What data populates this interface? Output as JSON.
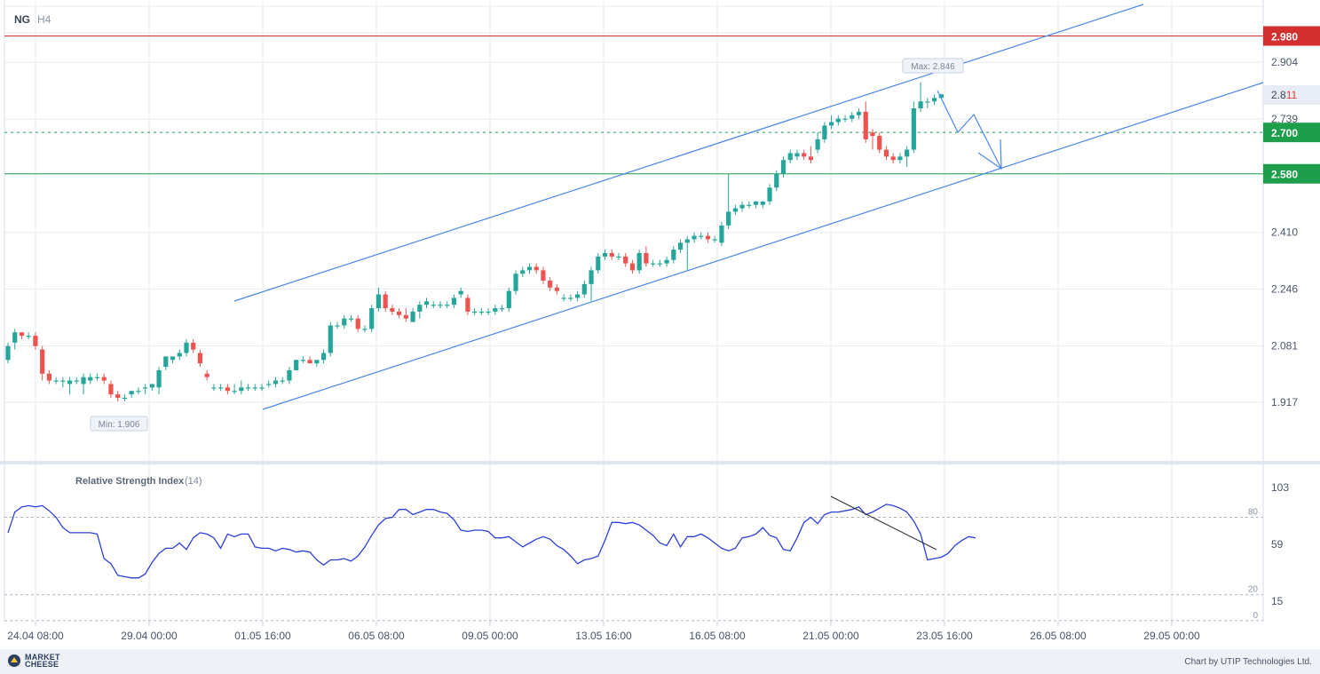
{
  "chart_data": {
    "type": "candlestick",
    "symbol": "NG",
    "timeframe": "H4",
    "x_ticks": [
      "24.04 08:00",
      "29.04 00:00",
      "01.05 16:00",
      "06.05 08:00",
      "09.05 00:00",
      "13.05 16:00",
      "16.05 08:00",
      "21.05 00:00",
      "23.05 16:00",
      "26.05 08:00",
      "29.05 00:00"
    ],
    "y_ticks": [
      "1.917",
      "2.081",
      "2.246",
      "2.410",
      "2.739",
      "2.904"
    ],
    "ylim": [
      1.75,
      3.05
    ],
    "candles": [
      {
        "o": 2.04,
        "h": 2.09,
        "l": 2.03,
        "c": 2.08
      },
      {
        "o": 2.09,
        "h": 2.13,
        "l": 2.07,
        "c": 2.12
      },
      {
        "o": 2.12,
        "h": 2.12,
        "l": 2.1,
        "c": 2.11
      },
      {
        "o": 2.11,
        "h": 2.12,
        "l": 2.1,
        "c": 2.11
      },
      {
        "o": 2.11,
        "h": 2.12,
        "l": 2.07,
        "c": 2.08
      },
      {
        "o": 2.07,
        "h": 2.08,
        "l": 1.98,
        "c": 2.0
      },
      {
        "o": 2.0,
        "h": 2.01,
        "l": 1.97,
        "c": 1.98
      },
      {
        "o": 1.98,
        "h": 1.99,
        "l": 1.97,
        "c": 1.98
      },
      {
        "o": 1.98,
        "h": 1.99,
        "l": 1.96,
        "c": 1.98
      },
      {
        "o": 1.97,
        "h": 1.99,
        "l": 1.94,
        "c": 1.98
      },
      {
        "o": 1.98,
        "h": 1.99,
        "l": 1.97,
        "c": 1.98
      },
      {
        "o": 1.97,
        "h": 2.0,
        "l": 1.94,
        "c": 1.99
      },
      {
        "o": 1.98,
        "h": 2.0,
        "l": 1.97,
        "c": 1.99
      },
      {
        "o": 1.99,
        "h": 2.0,
        "l": 1.98,
        "c": 1.99
      },
      {
        "o": 1.99,
        "h": 2.0,
        "l": 1.97,
        "c": 1.98
      },
      {
        "o": 1.97,
        "h": 1.98,
        "l": 1.93,
        "c": 1.94
      },
      {
        "o": 1.94,
        "h": 1.95,
        "l": 1.92,
        "c": 1.93
      },
      {
        "o": 1.93,
        "h": 1.94,
        "l": 1.92,
        "c": 1.93
      },
      {
        "o": 1.94,
        "h": 1.95,
        "l": 1.93,
        "c": 1.95
      },
      {
        "o": 1.95,
        "h": 1.96,
        "l": 1.94,
        "c": 1.95
      },
      {
        "o": 1.96,
        "h": 1.97,
        "l": 1.94,
        "c": 1.96
      },
      {
        "o": 1.96,
        "h": 1.97,
        "l": 1.95,
        "c": 1.97
      },
      {
        "o": 1.96,
        "h": 2.02,
        "l": 1.94,
        "c": 2.01
      },
      {
        "o": 2.02,
        "h": 2.05,
        "l": 2.01,
        "c": 2.05
      },
      {
        "o": 2.04,
        "h": 2.05,
        "l": 2.03,
        "c": 2.05
      },
      {
        "o": 2.05,
        "h": 2.07,
        "l": 2.04,
        "c": 2.06
      },
      {
        "o": 2.06,
        "h": 2.1,
        "l": 2.05,
        "c": 2.09
      },
      {
        "o": 2.09,
        "h": 2.1,
        "l": 2.06,
        "c": 2.07
      },
      {
        "o": 2.06,
        "h": 2.07,
        "l": 2.02,
        "c": 2.03
      },
      {
        "o": 2.0,
        "h": 2.01,
        "l": 1.98,
        "c": 1.99
      },
      {
        "o": 1.96,
        "h": 1.97,
        "l": 1.95,
        "c": 1.96
      },
      {
        "o": 1.96,
        "h": 1.97,
        "l": 1.95,
        "c": 1.96
      },
      {
        "o": 1.96,
        "h": 1.97,
        "l": 1.94,
        "c": 1.95
      },
      {
        "o": 1.95,
        "h": 1.97,
        "l": 1.94,
        "c": 1.95
      },
      {
        "o": 1.95,
        "h": 1.98,
        "l": 1.94,
        "c": 1.96
      },
      {
        "o": 1.96,
        "h": 1.97,
        "l": 1.95,
        "c": 1.96
      },
      {
        "o": 1.96,
        "h": 1.97,
        "l": 1.95,
        "c": 1.96
      },
      {
        "o": 1.96,
        "h": 1.97,
        "l": 1.95,
        "c": 1.96
      },
      {
        "o": 1.97,
        "h": 1.98,
        "l": 1.96,
        "c": 1.97
      },
      {
        "o": 1.97,
        "h": 1.99,
        "l": 1.96,
        "c": 1.98
      },
      {
        "o": 1.98,
        "h": 1.99,
        "l": 1.97,
        "c": 1.98
      },
      {
        "o": 1.98,
        "h": 2.02,
        "l": 1.97,
        "c": 2.01
      },
      {
        "o": 2.01,
        "h": 2.04,
        "l": 2.01,
        "c": 2.04
      },
      {
        "o": 2.04,
        "h": 2.05,
        "l": 2.03,
        "c": 2.04
      },
      {
        "o": 2.04,
        "h": 2.05,
        "l": 2.03,
        "c": 2.03
      },
      {
        "o": 2.03,
        "h": 2.04,
        "l": 2.02,
        "c": 2.04
      },
      {
        "o": 2.04,
        "h": 2.07,
        "l": 2.03,
        "c": 2.06
      },
      {
        "o": 2.06,
        "h": 2.15,
        "l": 2.05,
        "c": 2.14
      },
      {
        "o": 2.14,
        "h": 2.15,
        "l": 2.13,
        "c": 2.14
      },
      {
        "o": 2.14,
        "h": 2.17,
        "l": 2.13,
        "c": 2.16
      },
      {
        "o": 2.16,
        "h": 2.17,
        "l": 2.15,
        "c": 2.16
      },
      {
        "o": 2.16,
        "h": 2.17,
        "l": 2.12,
        "c": 2.13
      },
      {
        "o": 2.13,
        "h": 2.14,
        "l": 2.12,
        "c": 2.13
      },
      {
        "o": 2.13,
        "h": 2.2,
        "l": 2.12,
        "c": 2.19
      },
      {
        "o": 2.19,
        "h": 2.25,
        "l": 2.18,
        "c": 2.23
      },
      {
        "o": 2.23,
        "h": 2.24,
        "l": 2.18,
        "c": 2.19
      },
      {
        "o": 2.19,
        "h": 2.2,
        "l": 2.17,
        "c": 2.18
      },
      {
        "o": 2.18,
        "h": 2.19,
        "l": 2.16,
        "c": 2.17
      },
      {
        "o": 2.17,
        "h": 2.19,
        "l": 2.15,
        "c": 2.16
      },
      {
        "o": 2.15,
        "h": 2.19,
        "l": 2.15,
        "c": 2.18
      },
      {
        "o": 2.18,
        "h": 2.21,
        "l": 2.16,
        "c": 2.2
      },
      {
        "o": 2.2,
        "h": 2.22,
        "l": 2.19,
        "c": 2.21
      },
      {
        "o": 2.2,
        "h": 2.21,
        "l": 2.19,
        "c": 2.2
      },
      {
        "o": 2.2,
        "h": 2.21,
        "l": 2.19,
        "c": 2.2
      },
      {
        "o": 2.2,
        "h": 2.21,
        "l": 2.19,
        "c": 2.2
      },
      {
        "o": 2.2,
        "h": 2.23,
        "l": 2.19,
        "c": 2.22
      },
      {
        "o": 2.23,
        "h": 2.25,
        "l": 2.22,
        "c": 2.24
      },
      {
        "o": 2.22,
        "h": 2.23,
        "l": 2.17,
        "c": 2.18
      },
      {
        "o": 2.18,
        "h": 2.19,
        "l": 2.17,
        "c": 2.18
      },
      {
        "o": 2.18,
        "h": 2.19,
        "l": 2.17,
        "c": 2.18
      },
      {
        "o": 2.18,
        "h": 2.19,
        "l": 2.17,
        "c": 2.18
      },
      {
        "o": 2.18,
        "h": 2.2,
        "l": 2.17,
        "c": 2.19
      },
      {
        "o": 2.19,
        "h": 2.2,
        "l": 2.18,
        "c": 2.19
      },
      {
        "o": 2.19,
        "h": 2.25,
        "l": 2.18,
        "c": 2.24
      },
      {
        "o": 2.24,
        "h": 2.3,
        "l": 2.23,
        "c": 2.29
      },
      {
        "o": 2.29,
        "h": 2.31,
        "l": 2.28,
        "c": 2.3
      },
      {
        "o": 2.3,
        "h": 2.32,
        "l": 2.29,
        "c": 2.31
      },
      {
        "o": 2.31,
        "h": 2.32,
        "l": 2.29,
        "c": 2.3
      },
      {
        "o": 2.3,
        "h": 2.31,
        "l": 2.26,
        "c": 2.27
      },
      {
        "o": 2.27,
        "h": 2.28,
        "l": 2.24,
        "c": 2.25
      },
      {
        "o": 2.25,
        "h": 2.26,
        "l": 2.23,
        "c": 2.24
      },
      {
        "o": 2.22,
        "h": 2.23,
        "l": 2.21,
        "c": 2.22
      },
      {
        "o": 2.22,
        "h": 2.23,
        "l": 2.21,
        "c": 2.22
      },
      {
        "o": 2.22,
        "h": 2.24,
        "l": 2.21,
        "c": 2.23
      },
      {
        "o": 2.23,
        "h": 2.27,
        "l": 2.22,
        "c": 2.26
      },
      {
        "o": 2.26,
        "h": 2.31,
        "l": 2.21,
        "c": 2.3
      },
      {
        "o": 2.3,
        "h": 2.35,
        "l": 2.29,
        "c": 2.34
      },
      {
        "o": 2.34,
        "h": 2.36,
        "l": 2.33,
        "c": 2.35
      },
      {
        "o": 2.35,
        "h": 2.36,
        "l": 2.33,
        "c": 2.34
      },
      {
        "o": 2.34,
        "h": 2.35,
        "l": 2.33,
        "c": 2.34
      },
      {
        "o": 2.34,
        "h": 2.35,
        "l": 2.31,
        "c": 2.32
      },
      {
        "o": 2.32,
        "h": 2.33,
        "l": 2.29,
        "c": 2.3
      },
      {
        "o": 2.3,
        "h": 2.36,
        "l": 2.29,
        "c": 2.35
      },
      {
        "o": 2.35,
        "h": 2.37,
        "l": 2.31,
        "c": 2.32
      },
      {
        "o": 2.32,
        "h": 2.33,
        "l": 2.31,
        "c": 2.32
      },
      {
        "o": 2.32,
        "h": 2.33,
        "l": 2.31,
        "c": 2.32
      },
      {
        "o": 2.32,
        "h": 2.34,
        "l": 2.31,
        "c": 2.33
      },
      {
        "o": 2.33,
        "h": 2.37,
        "l": 2.32,
        "c": 2.36
      },
      {
        "o": 2.36,
        "h": 2.39,
        "l": 2.35,
        "c": 2.38
      },
      {
        "o": 2.38,
        "h": 2.4,
        "l": 2.3,
        "c": 2.39
      },
      {
        "o": 2.39,
        "h": 2.41,
        "l": 2.38,
        "c": 2.4
      },
      {
        "o": 2.4,
        "h": 2.41,
        "l": 2.39,
        "c": 2.4
      },
      {
        "o": 2.4,
        "h": 2.41,
        "l": 2.38,
        "c": 2.39
      },
      {
        "o": 2.39,
        "h": 2.4,
        "l": 2.38,
        "c": 2.39
      },
      {
        "o": 2.38,
        "h": 2.44,
        "l": 2.37,
        "c": 2.43
      },
      {
        "o": 2.43,
        "h": 2.58,
        "l": 2.42,
        "c": 2.47
      },
      {
        "o": 2.47,
        "h": 2.49,
        "l": 2.46,
        "c": 2.48
      },
      {
        "o": 2.48,
        "h": 2.5,
        "l": 2.47,
        "c": 2.49
      },
      {
        "o": 2.49,
        "h": 2.5,
        "l": 2.48,
        "c": 2.49
      },
      {
        "o": 2.49,
        "h": 2.5,
        "l": 2.48,
        "c": 2.5
      },
      {
        "o": 2.49,
        "h": 2.5,
        "l": 2.48,
        "c": 2.5
      },
      {
        "o": 2.5,
        "h": 2.55,
        "l": 2.49,
        "c": 2.54
      },
      {
        "o": 2.54,
        "h": 2.59,
        "l": 2.53,
        "c": 2.58
      },
      {
        "o": 2.58,
        "h": 2.63,
        "l": 2.57,
        "c": 2.62
      },
      {
        "o": 2.62,
        "h": 2.65,
        "l": 2.61,
        "c": 2.64
      },
      {
        "o": 2.63,
        "h": 2.65,
        "l": 2.62,
        "c": 2.64
      },
      {
        "o": 2.64,
        "h": 2.65,
        "l": 2.62,
        "c": 2.63
      },
      {
        "o": 2.63,
        "h": 2.66,
        "l": 2.61,
        "c": 2.62
      },
      {
        "o": 2.65,
        "h": 2.7,
        "l": 2.64,
        "c": 2.68
      },
      {
        "o": 2.68,
        "h": 2.73,
        "l": 2.67,
        "c": 2.72
      },
      {
        "o": 2.72,
        "h": 2.75,
        "l": 2.71,
        "c": 2.73
      },
      {
        "o": 2.73,
        "h": 2.75,
        "l": 2.72,
        "c": 2.74
      },
      {
        "o": 2.74,
        "h": 2.75,
        "l": 2.73,
        "c": 2.74
      },
      {
        "o": 2.74,
        "h": 2.76,
        "l": 2.73,
        "c": 2.75
      },
      {
        "o": 2.75,
        "h": 2.77,
        "l": 2.74,
        "c": 2.76
      },
      {
        "o": 2.76,
        "h": 2.79,
        "l": 2.67,
        "c": 2.68
      },
      {
        "o": 2.7,
        "h": 2.71,
        "l": 2.65,
        "c": 2.69
      },
      {
        "o": 2.69,
        "h": 2.7,
        "l": 2.64,
        "c": 2.65
      },
      {
        "o": 2.65,
        "h": 2.66,
        "l": 2.62,
        "c": 2.63
      },
      {
        "o": 2.63,
        "h": 2.64,
        "l": 2.61,
        "c": 2.62
      },
      {
        "o": 2.62,
        "h": 2.64,
        "l": 2.61,
        "c": 2.63
      },
      {
        "o": 2.63,
        "h": 2.66,
        "l": 2.6,
        "c": 2.65
      },
      {
        "o": 2.65,
        "h": 2.79,
        "l": 2.64,
        "c": 2.77
      },
      {
        "o": 2.77,
        "h": 2.846,
        "l": 2.76,
        "c": 2.79
      },
      {
        "o": 2.79,
        "h": 2.8,
        "l": 2.77,
        "c": 2.79
      },
      {
        "o": 2.79,
        "h": 2.81,
        "l": 2.78,
        "c": 2.8
      },
      {
        "o": 2.8,
        "h": 2.811,
        "l": 2.8,
        "c": 2.811
      }
    ],
    "rsi": {
      "label": "Relative Strength Index",
      "period": "(14)",
      "ylim": [
        0,
        103
      ],
      "y_ticks": [
        "103",
        "59",
        "15"
      ],
      "levels": [
        80,
        20,
        0
      ],
      "level_labels": [
        "80",
        "20",
        "0"
      ],
      "values": [
        68,
        84,
        88,
        89,
        88,
        89,
        85,
        80,
        72,
        68,
        68,
        68,
        68,
        67,
        48,
        44,
        35,
        34,
        33,
        33,
        36,
        45,
        52,
        56,
        56,
        60,
        55,
        64,
        68,
        67,
        64,
        56,
        67,
        65,
        67,
        67,
        57,
        56,
        56,
        54,
        56,
        55,
        53,
        54,
        53,
        47,
        43,
        47,
        47,
        48,
        46,
        50,
        57,
        66,
        74,
        79,
        80,
        86,
        86,
        82,
        84,
        86,
        86,
        84,
        83,
        78,
        70,
        69,
        70,
        70,
        69,
        64,
        64,
        65,
        61,
        57,
        60,
        63,
        65,
        63,
        58,
        55,
        50,
        44,
        47,
        48,
        50,
        62,
        76,
        76,
        75,
        76,
        74,
        70,
        66,
        60,
        58,
        67,
        57,
        65,
        65,
        67,
        64,
        60,
        56,
        54,
        56,
        64,
        65,
        67,
        72,
        66,
        64,
        55,
        54,
        64,
        76,
        80,
        75,
        82,
        84,
        84,
        85,
        86,
        88,
        82,
        84,
        87,
        90,
        89,
        87,
        84,
        77,
        67,
        47,
        48,
        49,
        52,
        58,
        62,
        65,
        64
      ],
      "trendline_label": ""
    },
    "horizontal_levels": [
      {
        "value": 2.98,
        "label": "2.980",
        "color": "#d32f2f",
        "style": "solid"
      },
      {
        "value": 2.7,
        "label": "2.700",
        "color": "#1e9e4a",
        "style": "dotted"
      },
      {
        "value": 2.58,
        "label": "2.580",
        "color": "#1e9e4a",
        "style": "solid"
      }
    ],
    "current_price": {
      "prefix": "2.8",
      "suffix": "11",
      "value": 2.811
    },
    "annotations": {
      "max": "Max: 2.846",
      "min": "Min: 1.906"
    },
    "colors": {
      "up": "#26a69a",
      "down": "#ef5350",
      "channel": "#4a86e8",
      "rsi_line": "#2c3fd6",
      "grid": "#e6eaf0"
    }
  },
  "footer": {
    "brand_line1": "MARKET",
    "brand_line2": "CHEESE",
    "credit": "Chart by UTIP Technologies Ltd."
  },
  "icons": {
    "brand_logo": "market-cheese-logo-icon"
  }
}
